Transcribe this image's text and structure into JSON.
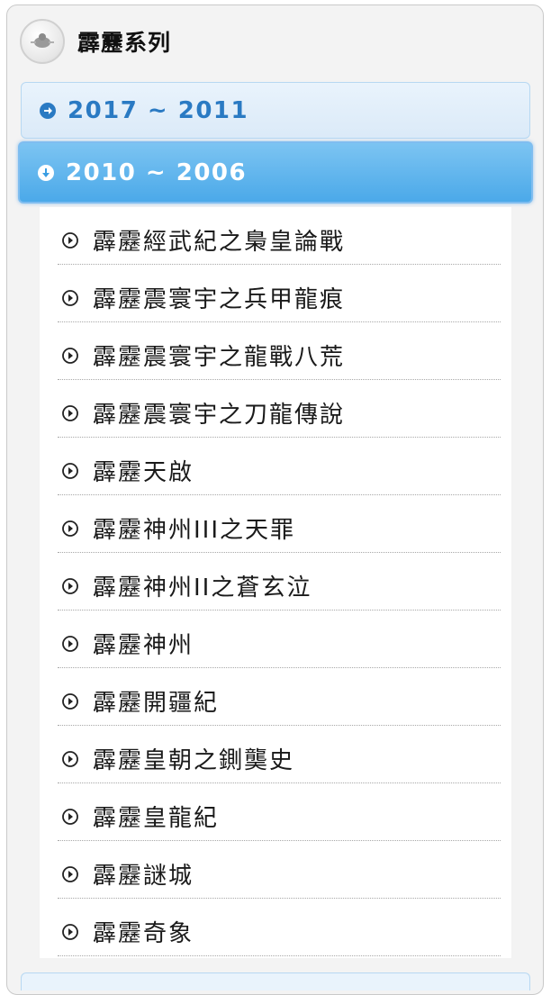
{
  "panel": {
    "title": "霹靂系列",
    "logo_icon": "puppet-logo-icon"
  },
  "tabs": [
    {
      "label": "2017 ~ 2011",
      "state": "collapsed",
      "icon": "arrow-right-circle-icon"
    },
    {
      "label": "2010 ~ 2006",
      "state": "expanded",
      "icon": "arrow-down-circle-icon"
    }
  ],
  "items": [
    {
      "label": "霹靂經武紀之梟皇論戰"
    },
    {
      "label": "霹靂震寰宇之兵甲龍痕"
    },
    {
      "label": "霹靂震寰宇之龍戰八荒"
    },
    {
      "label": "霹靂震寰宇之刀龍傳說"
    },
    {
      "label": "霹靂天啟"
    },
    {
      "label": "霹靂神州III之天罪"
    },
    {
      "label": "霹靂神州II之蒼玄泣"
    },
    {
      "label": "霹靂神州"
    },
    {
      "label": "霹靂開疆紀"
    },
    {
      "label": "霹靂皇朝之鍘龑史"
    },
    {
      "label": "霹靂皇龍紀"
    },
    {
      "label": "霹靂謎城"
    },
    {
      "label": "霹靂奇象"
    }
  ],
  "colors": {
    "tab_collapsed_text": "#2a7ac3",
    "tab_expanded_bg": "#4ba9e9",
    "tab_expanded_text": "#ffffff"
  }
}
